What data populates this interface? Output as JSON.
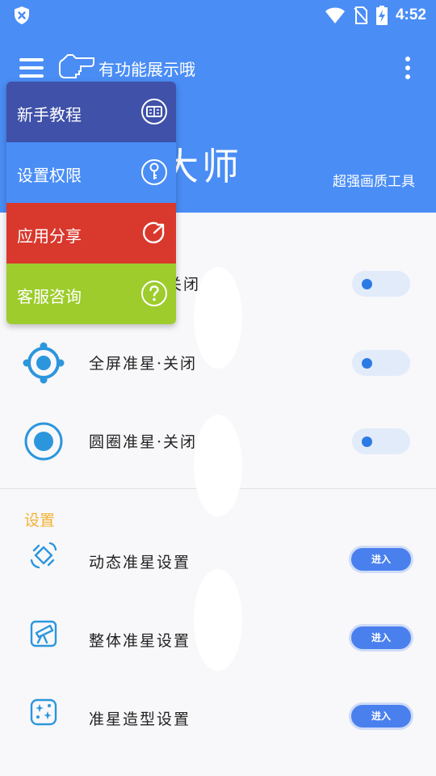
{
  "status_bar": {
    "time": "4:52",
    "icons": [
      "shield-x-icon",
      "wifi-icon",
      "no-sim-icon",
      "battery-charging-icon"
    ]
  },
  "app_bar": {
    "title": "有功能展示哦",
    "brand_visible_chars": "大师",
    "subtitle": "超强画质工具",
    "color": "#4a8df5"
  },
  "menu": {
    "items": [
      {
        "label": "新手教程",
        "icon": "book-icon",
        "color": "#3f51a8"
      },
      {
        "label": "设置权限",
        "icon": "key-icon",
        "color": "#4a8df5"
      },
      {
        "label": "应用分享",
        "icon": "share-icon",
        "color": "#d9382d"
      },
      {
        "label": "客服咨询",
        "icon": "help-icon",
        "color": "#9dcc2c"
      }
    ]
  },
  "toggles": [
    {
      "label_visible": "关闭",
      "state": "off"
    },
    {
      "label": "全屏准星·关闭",
      "state": "off",
      "icon": "target-crosshair-icon"
    },
    {
      "label": "圆圈准星·关闭",
      "state": "off",
      "icon": "circle-crosshair-icon"
    }
  ],
  "settings": {
    "section_title": "设置",
    "items": [
      {
        "label": "动态准星设置",
        "button": "进入",
        "icon": "satellite-icon"
      },
      {
        "label": "整体准星设置",
        "button": "进入",
        "icon": "telescope-icon"
      },
      {
        "label": "准星造型设置",
        "button": "进入",
        "icon": "sparkle-icon"
      }
    ]
  },
  "colors": {
    "accent": "#4a8df5",
    "section_title": "#f2b233",
    "toggle_dot": "#2c7be5",
    "button": "#4a80ee"
  }
}
